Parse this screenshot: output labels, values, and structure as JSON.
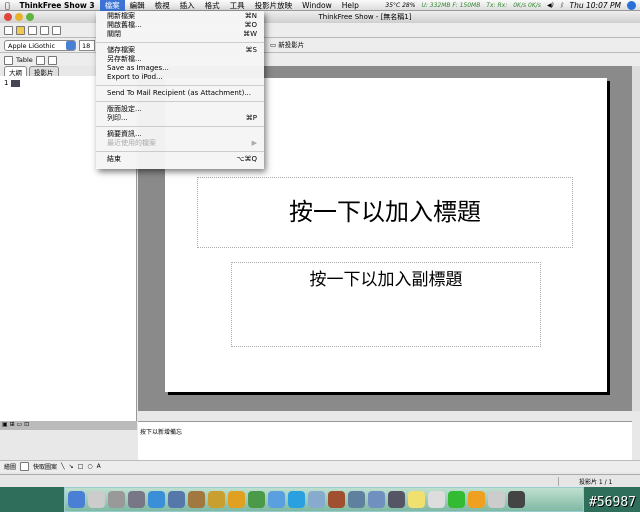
{
  "menubar": {
    "app": "ThinkFree Show 3",
    "items": [
      "檔案",
      "編輯",
      "檢視",
      "插入",
      "格式",
      "工具",
      "投影片放映",
      "Window",
      "Help"
    ],
    "status": {
      "temp": "35°C 28%",
      "mem": "U: 332MB F: 150MB",
      "net": "Tx: Rx:",
      "rate": "0K/s 0K/s",
      "clock": "Thu 10:07 PM"
    }
  },
  "window": {
    "title": "ThinkFree Show - [無名稱1]"
  },
  "toolbar": {
    "font": "Apple LiGothic",
    "size": "18",
    "table": "Table",
    "new_slide": "新投影片"
  },
  "left": {
    "tabs": [
      "大綱",
      "投影片"
    ],
    "slide_num": "1"
  },
  "file_menu": [
    {
      "label": "開新檔案",
      "shortcut": "⌘N"
    },
    {
      "label": "開啟舊檔...",
      "shortcut": "⌘O"
    },
    {
      "label": "關閉",
      "shortcut": "⌘W"
    },
    {
      "sep": true
    },
    {
      "label": "儲存檔案",
      "shortcut": "⌘S"
    },
    {
      "label": "另存新檔...",
      "shortcut": ""
    },
    {
      "label": "Save as Images...",
      "shortcut": ""
    },
    {
      "label": "Export to iPod...",
      "shortcut": ""
    },
    {
      "sep": true
    },
    {
      "label": "Send To Mail Recipient (as Attachment)...",
      "shortcut": ""
    },
    {
      "sep": true
    },
    {
      "label": "版面設定...",
      "shortcut": ""
    },
    {
      "label": "列印...",
      "shortcut": "⌘P"
    },
    {
      "sep": true
    },
    {
      "label": "摘要資訊...",
      "shortcut": ""
    },
    {
      "label": "最近使用的檔案",
      "shortcut": "▶",
      "disabled": true
    },
    {
      "sep": true
    },
    {
      "label": "結束",
      "shortcut": "⌥⌘Q"
    }
  ],
  "slide": {
    "title_placeholder": "按一下以加入標題",
    "subtitle_placeholder": "按一下以加入副標題"
  },
  "notes": {
    "placeholder": "按下以新增備忘"
  },
  "drawbar": {
    "draw": "繪圖",
    "autoshapes": "快取圖案"
  },
  "status": {
    "slide_count": "投影片 1 / 1"
  },
  "watermark": "#56987"
}
